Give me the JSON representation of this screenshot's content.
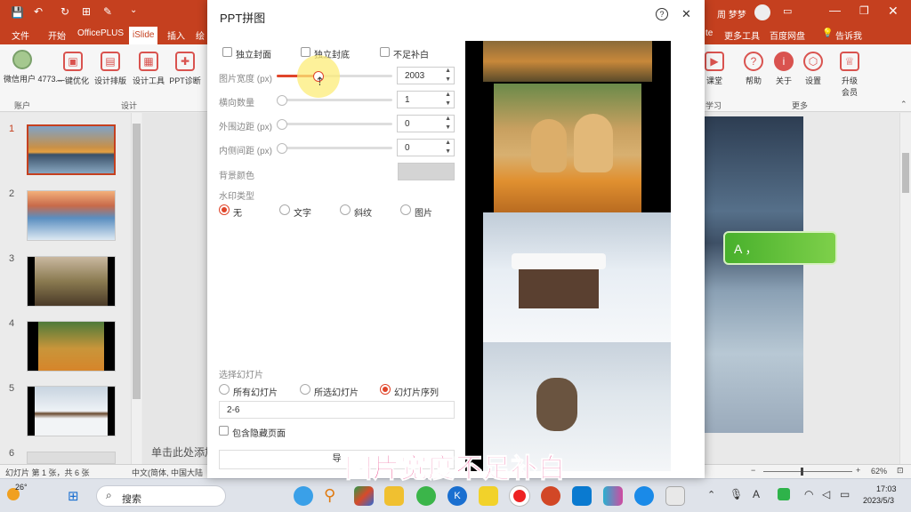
{
  "ppt": {
    "tabs": [
      "文件",
      "开始",
      "OfficePLUS",
      "iSlide",
      "插入",
      "绘",
      "te",
      "更多工具",
      "百度网盘",
      "告诉我"
    ],
    "user": "周 梦梦",
    "ribbon_left": [
      {
        "icon": "user-avatar-icon",
        "label": "微信用户 4773..."
      },
      {
        "icon": "optimize-icon",
        "label": "一键优化"
      },
      {
        "icon": "layout-icon",
        "label": "设计排版"
      },
      {
        "icon": "tools-icon",
        "label": "设计工具"
      },
      {
        "icon": "diagnose-icon",
        "label": "PPT诊断"
      }
    ],
    "group_account": "账户",
    "group_design": "设计",
    "group_study": "学习",
    "group_more": "更多",
    "ribbon_right": [
      {
        "icon": "course-icon",
        "label": "课堂"
      },
      {
        "icon": "help-icon",
        "label": "帮助"
      },
      {
        "icon": "about-icon",
        "label": "关于"
      },
      {
        "icon": "settings-icon",
        "label": "设置"
      },
      {
        "icon": "upgrade-icon",
        "label": "升级 会员"
      }
    ],
    "slide_numbers": [
      "1",
      "2",
      "3",
      "4",
      "5",
      "6"
    ],
    "notes_placeholder": "单击此处添加",
    "status": {
      "slide": "幻灯片 第 1 张，共 6 张",
      "lang": "中文(简体, 中国大陆",
      "zoom": "62%"
    },
    "slide_text": "A  ，"
  },
  "dialog": {
    "title": "PPT拼图",
    "opt_cover1": "独立封面",
    "opt_cover2": "独立封底",
    "opt_fill": "不足补白",
    "width_label": "图片宽度 (px)",
    "width_value": "2003",
    "width_fraction": 0.4,
    "count_label": "横向数量",
    "count_value": "1",
    "outer_label": "外围边距 (px)",
    "outer_value": "0",
    "inner_label": "内侧间距 (px)",
    "inner_value": "0",
    "bg_label": "背景颜色",
    "bg_color": "#d4d4d4",
    "wm_label": "水印类型",
    "wm_options": [
      "无",
      "文字",
      "斜纹",
      "图片"
    ],
    "select_label": "选择幻灯片",
    "sel_options": [
      "所有幻灯片",
      "所选幻灯片",
      "幻灯片序列"
    ],
    "range_value": "2-6",
    "hidden_label": "包含隐藏页面",
    "button_partial": "导"
  },
  "subtitle": "图片宽度不足补白",
  "taskbar": {
    "weather": "26°",
    "search": "搜索",
    "time": "17:03",
    "date": "2023/5/3"
  }
}
